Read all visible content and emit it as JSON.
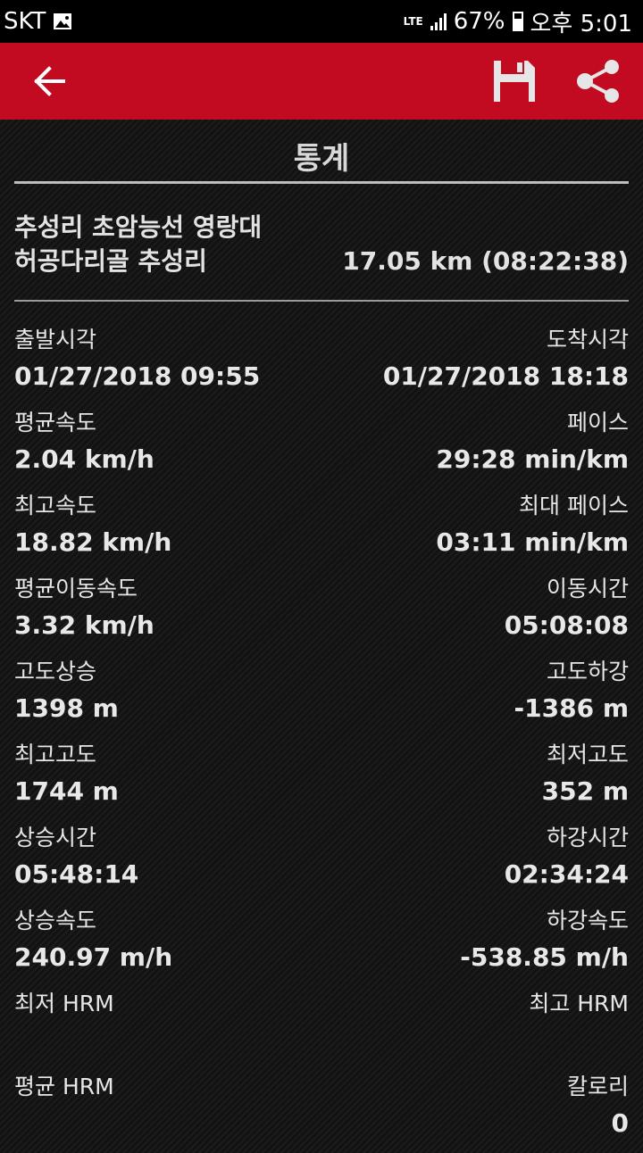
{
  "status_bar": {
    "carrier": "SKT",
    "network": "LTE",
    "battery": "67%",
    "time": "오후 5:01"
  },
  "toolbar": {
    "back_icon": "arrow-left-icon",
    "save_icon": "floppy-disk-icon",
    "share_icon": "share-icon"
  },
  "section": {
    "title": "통계"
  },
  "route": {
    "name_line1": "추성리 초암능선 영랑대",
    "name_line2": "허공다리골 추성리",
    "distance_time": "17.05 km (08:22:38)"
  },
  "stats": [
    {
      "left_label": "출발시각",
      "left_value": "01/27/2018 09:55",
      "right_label": "도착시각",
      "right_value": "01/27/2018 18:18"
    },
    {
      "left_label": "평균속도",
      "left_value": "2.04 km/h",
      "right_label": "페이스",
      "right_value": "29:28 min/km"
    },
    {
      "left_label": "최고속도",
      "left_value": "18.82 km/h",
      "right_label": "최대 페이스",
      "right_value": "03:11 min/km"
    },
    {
      "left_label": "평균이동속도",
      "left_value": "3.32 km/h",
      "right_label": "이동시간",
      "right_value": "05:08:08"
    },
    {
      "left_label": "고도상승",
      "left_value": "1398 m",
      "right_label": "고도하강",
      "right_value": "-1386 m"
    },
    {
      "left_label": "최고고도",
      "left_value": "1744 m",
      "right_label": "최저고도",
      "right_value": "352 m"
    },
    {
      "left_label": "상승시간",
      "left_value": "05:48:14",
      "right_label": "하강시간",
      "right_value": "02:34:24"
    },
    {
      "left_label": "상승속도",
      "left_value": "240.97 m/h",
      "right_label": "하강속도",
      "right_value": "-538.85 m/h"
    },
    {
      "left_label": "최저 HRM",
      "left_value": "",
      "right_label": "최고 HRM",
      "right_value": ""
    },
    {
      "left_label": "평균 HRM",
      "left_value": "",
      "right_label": "칼로리",
      "right_value": "0"
    }
  ]
}
